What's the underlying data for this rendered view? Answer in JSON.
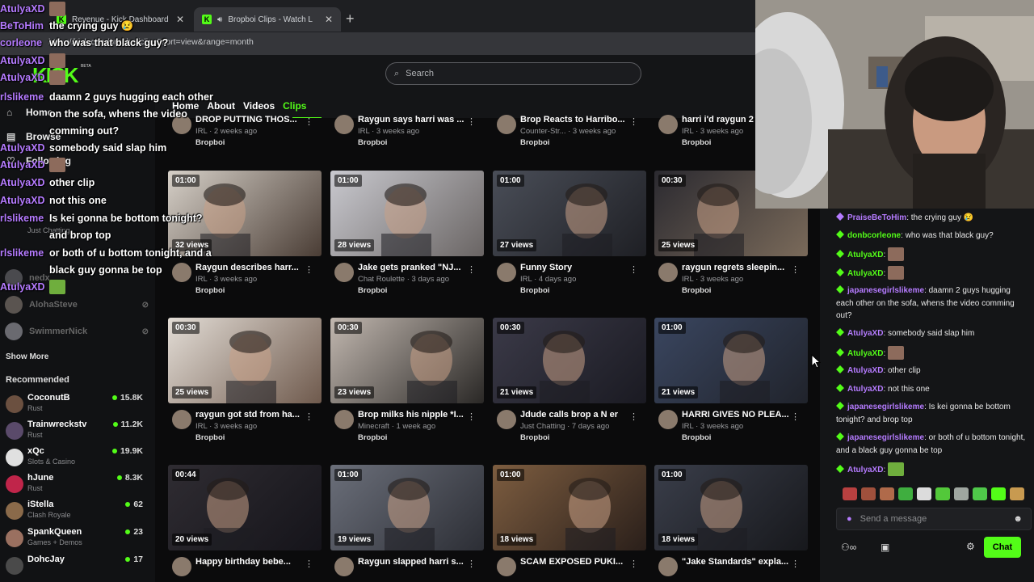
{
  "browser": {
    "tabs": [
      {
        "title": "Revenue - Kick Dashboard"
      },
      {
        "title": "Bropboi Clips - Watch Live on Kick"
      }
    ],
    "url": "https://kick.com/bropboi/clips?sort=view&range=month"
  },
  "header": {
    "logo": "KICK",
    "beta": "BETA",
    "search_placeholder": "Search",
    "nav": [
      "Home",
      "About",
      "Videos",
      "Clips"
    ]
  },
  "sidebar": {
    "nav": [
      "Home",
      "Browse",
      "Following"
    ],
    "following": [
      {
        "name": "nedx"
      },
      {
        "name": "AlohaSteve"
      },
      {
        "name": "SwimmerNick"
      }
    ],
    "following_cat": "Just Chatting",
    "show_more": "Show More",
    "recommended_title": "Recommended",
    "recommended": [
      {
        "name": "CoconutB",
        "category": "Rust",
        "viewers": "15.8K"
      },
      {
        "name": "Trainwreckstv",
        "category": "Rust",
        "viewers": "11.2K"
      },
      {
        "name": "xQc",
        "category": "Slots & Casino",
        "viewers": "19.9K"
      },
      {
        "name": "hJune",
        "category": "Rust",
        "viewers": "8.3K"
      },
      {
        "name": "iStella",
        "category": "Clash Royale",
        "viewers": "62"
      },
      {
        "name": "SpankQueen",
        "category": "Games + Demos",
        "viewers": "23"
      },
      {
        "name": "DohcJay",
        "category": "",
        "viewers": "17"
      }
    ]
  },
  "clips_top_row": [
    {
      "title": "DROP PUTTING THOS...",
      "sub": "IRL · 2 weeks ago",
      "channel": "Bropboi"
    },
    {
      "title": "Raygun says harri was ...",
      "sub": "IRL · 3 weeks ago",
      "channel": "Bropboi"
    },
    {
      "title": "Brop Reacts to Harribo...",
      "sub": "Counter-Str... · 3 weeks ago",
      "channel": "Bropboi"
    },
    {
      "title": "harri i'd raygun 2",
      "sub": "IRL · 3 weeks ago",
      "channel": "Bropboi"
    }
  ],
  "clips": [
    {
      "duration": "01:00",
      "views": "32 views",
      "title": "Raygun describes harr...",
      "sub": "IRL · 3 weeks ago",
      "channel": "Bropboi",
      "c1": "#d6d0c8",
      "c2": "#4a3d35"
    },
    {
      "duration": "01:00",
      "views": "28 views",
      "title": "Jake gets pranked \"NJ...",
      "sub": "Chat Roulette · 3 days ago",
      "channel": "Bropboi",
      "c1": "#c9c9cf",
      "c2": "#6a6564"
    },
    {
      "duration": "01:00",
      "views": "27 views",
      "title": "Funny Story",
      "sub": "IRL · 4 days ago",
      "channel": "Bropboi",
      "c1": "#4a4e58",
      "c2": "#1e1f24"
    },
    {
      "duration": "00:30",
      "views": "25 views",
      "title": "raygun regrets sleepin...",
      "sub": "IRL · 3 weeks ago",
      "channel": "Bropboi",
      "c1": "#2b2a30",
      "c2": "#7a6a5a"
    },
    {
      "duration": "00:30",
      "views": "25 views",
      "title": "raygun got std from ha...",
      "sub": "IRL · 3 weeks ago",
      "channel": "Bropboi",
      "c1": "#e3ddd6",
      "c2": "#6f5a4d"
    },
    {
      "duration": "00:30",
      "views": "23 views",
      "title": "Brop milks his nipple *I...",
      "sub": "Minecraft · 1 week ago",
      "channel": "Bropboi",
      "c1": "#c2b8b0",
      "c2": "#2a2826"
    },
    {
      "duration": "00:30",
      "views": "21 views",
      "title": "Jdude calls brop a N er",
      "sub": "Just Chatting · 7 days ago",
      "channel": "Bropboi",
      "c1": "#3b3a48",
      "c2": "#1a1a22"
    },
    {
      "duration": "01:00",
      "views": "21 views",
      "title": "HARRI GIVES NO PLEA...",
      "sub": "IRL · 3 weeks ago",
      "channel": "Bropboi",
      "c1": "#3a4660",
      "c2": "#20232b"
    },
    {
      "duration": "00:44",
      "views": "20 views",
      "title": "Happy birthday bebe...",
      "sub": "",
      "channel": "",
      "c1": "#2f2c32",
      "c2": "#15141a"
    },
    {
      "duration": "01:00",
      "views": "19 views",
      "title": "Raygun slapped harri s...",
      "sub": "",
      "channel": "",
      "c1": "#6b6f7a",
      "c2": "#2c2e35"
    },
    {
      "duration": "01:00",
      "views": "18 views",
      "title": "SCAM EXPOSED PUKI...",
      "sub": "",
      "channel": "",
      "c1": "#7d5d40",
      "c2": "#2a1f1a"
    },
    {
      "duration": "01:00",
      "views": "18 views",
      "title": "\"Jake Standards\" expla...",
      "sub": "",
      "channel": "",
      "c1": "#3a3e4a",
      "c2": "#17181c"
    }
  ],
  "chat": {
    "messages": [
      {
        "user": "PraiseBeToHim",
        "text": "the crying guy 😢",
        "color": "#b57bff"
      },
      {
        "user": "donbcorleone",
        "text": "who was that black guy?",
        "color": "#53fc18"
      },
      {
        "user": "AtulyaXD",
        "text": "",
        "color": "#53fc18"
      },
      {
        "user": "AtulyaXD",
        "text": "",
        "color": "#53fc18"
      },
      {
        "user": "japanesegirlslikeme",
        "text": "daamn 2 guys hugging each other on the sofa, whens the video comming out?",
        "color": "#b57bff"
      },
      {
        "user": "AtulyaXD",
        "text": "somebody said slap him",
        "color": "#b57bff"
      },
      {
        "user": "AtulyaXD",
        "text": "",
        "color": "#53fc18"
      },
      {
        "user": "AtulyaXD",
        "text": "other clip",
        "color": "#b57bff"
      },
      {
        "user": "AtulyaXD",
        "text": "not this one",
        "color": "#b57bff"
      },
      {
        "user": "japanesegirlslikeme",
        "text": "Is kei gonna be bottom tonight? and brop top",
        "color": "#b57bff"
      },
      {
        "user": "japanesegirlslikeme",
        "text": "or both of u bottom tonight, and a black guy gonna be top",
        "color": "#b57bff"
      },
      {
        "user": "AtulyaXD",
        "text": "",
        "color": "#b57bff"
      }
    ],
    "input_placeholder": "Send a message",
    "chat_button": "Chat"
  },
  "overlay": [
    {
      "user": "AtulyaXD",
      "text": ""
    },
    {
      "user": "BeToHim",
      "text": "the crying guy 😢"
    },
    {
      "user": "corleone",
      "text": "who was that black guy?"
    },
    {
      "user": "AtulyaXD",
      "text": ""
    },
    {
      "user": "AtulyaXD",
      "text": ""
    },
    {
      "user": "rlslikeme",
      "text": "daamn 2 guys hugging each other"
    },
    {
      "user": "",
      "text": "on the sofa, whens the video"
    },
    {
      "user": "",
      "text": "comming out?"
    },
    {
      "user": "AtulyaXD",
      "text": "somebody said slap him"
    },
    {
      "user": "AtulyaXD",
      "text": ""
    },
    {
      "user": "AtulyaXD",
      "text": "other clip"
    },
    {
      "user": "AtulyaXD",
      "text": "not this one"
    },
    {
      "user": "rlslikeme",
      "text": "Is kei gonna be bottom tonight?"
    },
    {
      "user": "",
      "text": "and brop top"
    },
    {
      "user": "rlslikeme",
      "text": "or both of u bottom tonight, and a"
    },
    {
      "user": "",
      "text": "black guy gonna be top"
    },
    {
      "user": "AtulyaXD",
      "text": ""
    }
  ],
  "colors": {
    "accent": "#53fc18",
    "overlay_user": "#b57bff"
  }
}
